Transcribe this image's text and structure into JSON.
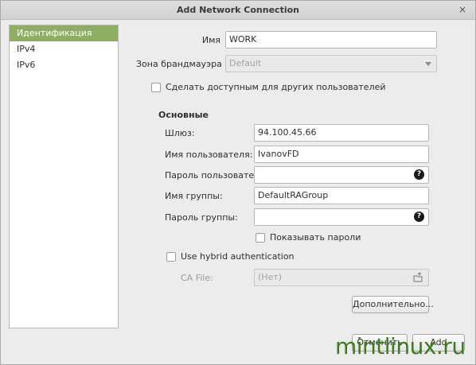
{
  "window": {
    "title": "Add Network Connection",
    "close_glyph": "×"
  },
  "sidebar": {
    "items": [
      {
        "label": "Идентификация",
        "active": true
      },
      {
        "label": "IPv4"
      },
      {
        "label": "IPv6"
      }
    ]
  },
  "identity": {
    "name_label": "Имя",
    "name_value": "WORK",
    "firewall_label": "Зона брандмауэра",
    "firewall_value": "Default",
    "available_label": "Сделать доступным для других пользователей"
  },
  "general": {
    "heading": "Основные",
    "gateway_label": "Шлюз:",
    "gateway_value": "94.100.45.66",
    "user_label": "Имя пользователя:",
    "user_value": "IvanovFD",
    "user_pass_label": "Пароль пользователя:",
    "user_pass_value": "",
    "group_label": "Имя группы:",
    "group_value": "DefaultRAGroup",
    "group_pass_label": "Пароль группы:",
    "group_pass_value": "",
    "show_pass_label": "Показывать пароли",
    "hybrid_label": "Use hybrid authentication",
    "ca_label": "CA File:",
    "ca_value": "(Нет)",
    "advanced_label": "Дополнительно...",
    "eye_glyph": "?"
  },
  "footer": {
    "cancel_label": "Отменить",
    "add_label": "Add"
  },
  "watermark": "mintlinux.ru"
}
